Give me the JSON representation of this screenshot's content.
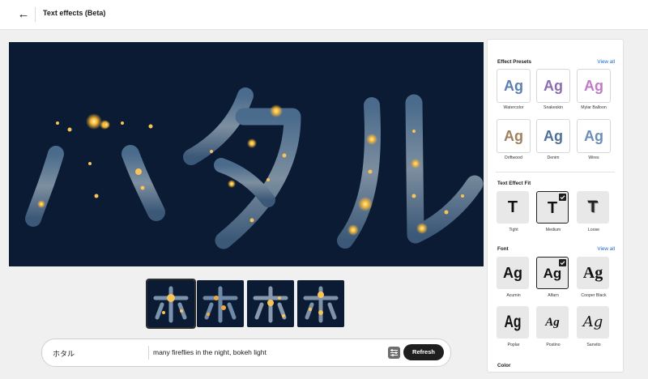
{
  "header": {
    "title": "Text effects (Beta)"
  },
  "canvas": {
    "text": "ホタル"
  },
  "prompt": {
    "text_value": "ホタル",
    "prompt_value": "many fireflies in the night, bokeh light",
    "refresh_label": "Refresh"
  },
  "panel": {
    "presets": {
      "title": "Effect Presets",
      "view_all": "View all",
      "items": [
        {
          "label": "Watercolor",
          "sample": "Ag",
          "color": "#5a7fb0"
        },
        {
          "label": "Snakeskin",
          "sample": "Ag",
          "color": "#8a6cb0"
        },
        {
          "label": "Mylar Balloon",
          "sample": "Ag",
          "color": "#c07ac8"
        },
        {
          "label": "Driftwood",
          "sample": "Ag",
          "color": "#a08060"
        },
        {
          "label": "Denim",
          "sample": "Ag",
          "color": "#4f7098"
        },
        {
          "label": "Wires",
          "sample": "Ag",
          "color": "#6a8fb8"
        }
      ]
    },
    "fit": {
      "title": "Text Effect Fit",
      "items": [
        {
          "label": "Tight",
          "sample": "T"
        },
        {
          "label": "Medium",
          "sample": "T"
        },
        {
          "label": "Loose",
          "sample": "T"
        }
      ]
    },
    "font": {
      "title": "Font",
      "view_all": "View all",
      "items": [
        {
          "label": "Acumin",
          "sample": "Ag"
        },
        {
          "label": "Alfarn",
          "sample": "Ag"
        },
        {
          "label": "Cooper Black",
          "sample": "Ag"
        },
        {
          "label": "Poplar",
          "sample": "Ag"
        },
        {
          "label": "Postino",
          "sample": "Ag"
        },
        {
          "label": "Sanvito",
          "sample": "Ag"
        }
      ]
    },
    "color": {
      "title": "Color"
    }
  }
}
